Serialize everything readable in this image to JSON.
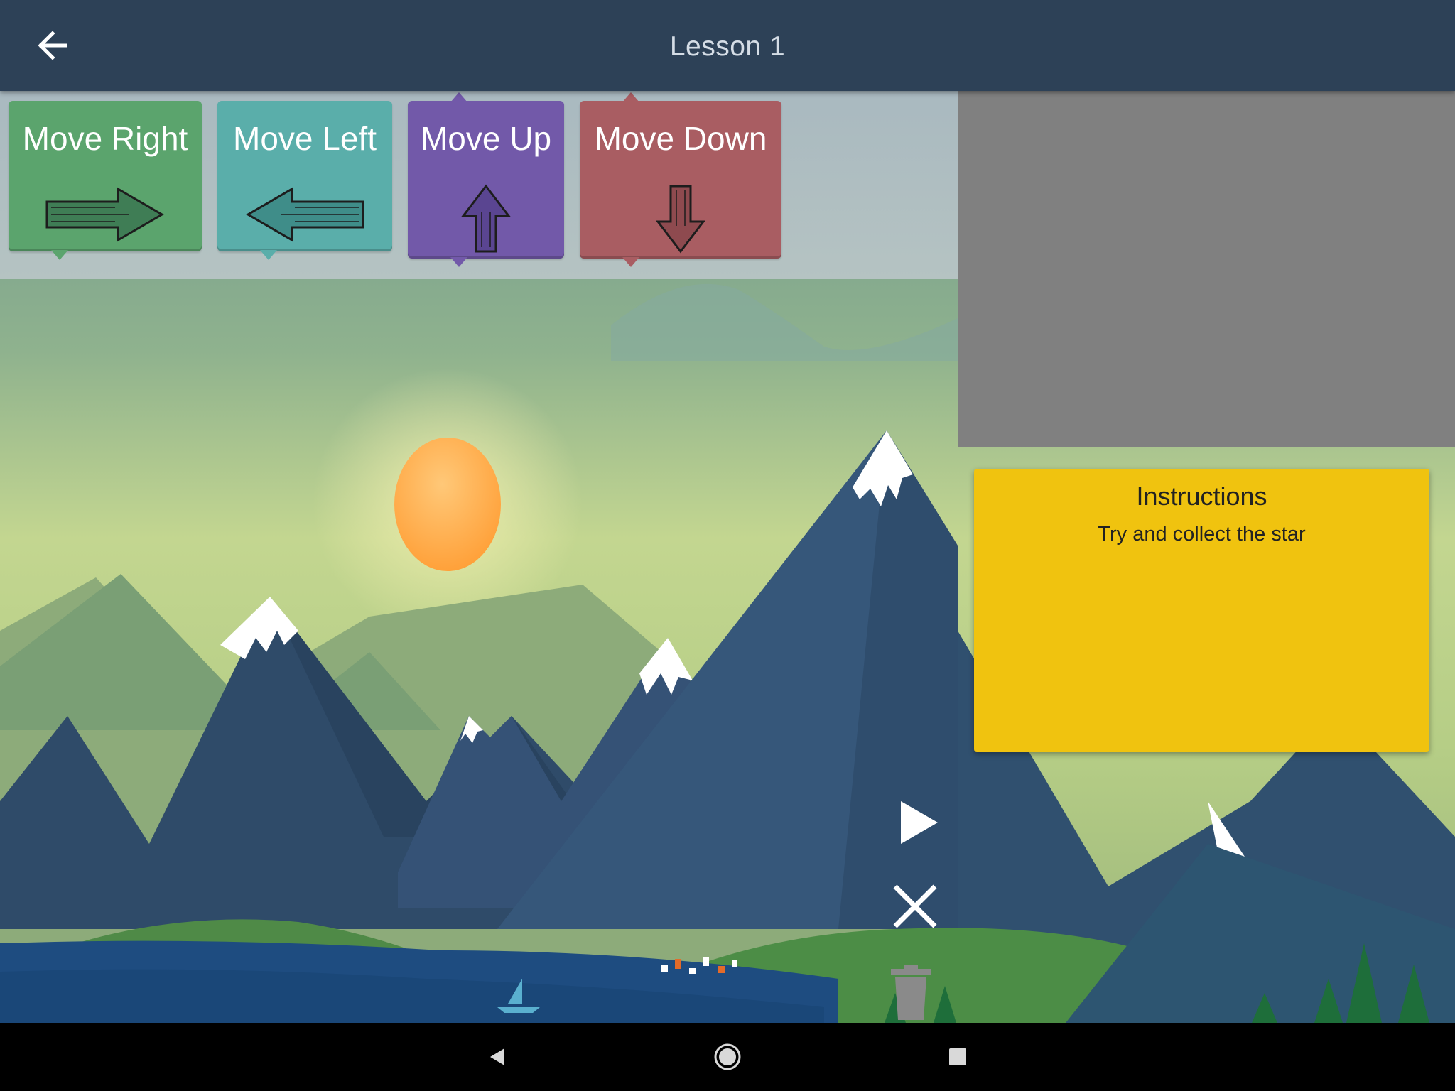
{
  "app_bar": {
    "title": "Lesson 1",
    "back_icon": "arrow-back-icon",
    "background": "#2d4157"
  },
  "palette": {
    "blocks": [
      {
        "label": "Move Right",
        "color": "#5ba46d",
        "icon": "arrow-right-icon"
      },
      {
        "label": "Move Left",
        "color": "#5aaeaa",
        "icon": "arrow-left-icon"
      },
      {
        "label": "Move Up",
        "color": "#7259a9",
        "icon": "arrow-up-icon"
      },
      {
        "label": "Move Down",
        "color": "#a95d62",
        "icon": "arrow-down-icon"
      }
    ]
  },
  "preview": {
    "color": "#808080"
  },
  "instructions": {
    "title": "Instructions",
    "text": "Try and collect the star",
    "color": "#f0c30f"
  },
  "controls": {
    "play_icon": "play-icon",
    "clear_icon": "close-icon",
    "trash_icon": "trash-icon"
  },
  "nav_bar": {
    "back_icon": "nav-back-icon",
    "home_icon": "nav-home-icon",
    "recents_icon": "nav-recents-icon"
  }
}
